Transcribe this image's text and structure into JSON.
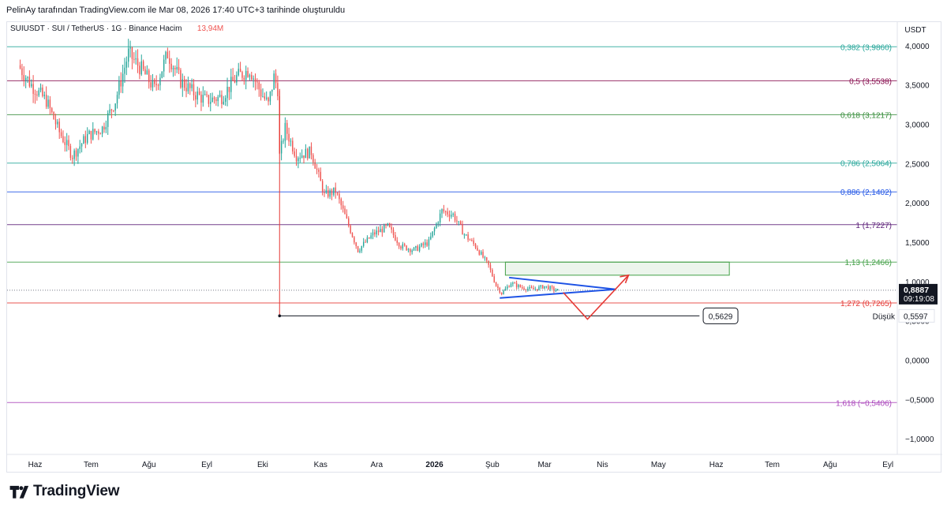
{
  "header": {
    "caption": "PelinAy tarafından TradingView.com ile Mar 08, 2026 17:40 UTC+3 tarihinde oluşturuldu"
  },
  "brand": {
    "name": "TradingView",
    "logo_icon": "tradingview-logo-icon"
  },
  "chart_data": {
    "type": "candlestick",
    "symbol_line": "SUIUSDT · SUI / TetherUS · 1G · Binance",
    "volume_label": "Hacim",
    "volume_value": "13,94M",
    "currency": "USDT",
    "ylim": [
      -1.2,
      4.3
    ],
    "y_ticks": [
      "4,0000",
      "3,5000",
      "3,0000",
      "2,5000",
      "2,0000",
      "1,5000",
      "1,0000",
      "0,5000",
      "0,0000",
      "−0,5000",
      "−1,0000"
    ],
    "x_ticks": [
      "Haz",
      "Tem",
      "Ağu",
      "Eyl",
      "Eki",
      "Kas",
      "Ara",
      "2026",
      "Şub",
      "Mar",
      "Nis",
      "May",
      "Haz",
      "Tem",
      "Ağu",
      "Eyl"
    ],
    "x_months": [
      "2025-06",
      "2025-07",
      "2025-08",
      "2025-09",
      "2025-10",
      "2025-11",
      "2025-12",
      "2026-01",
      "2026-02",
      "2026-03",
      "2026-04",
      "2026-05",
      "2026-06",
      "2026-07",
      "2026-08",
      "2026-09"
    ],
    "price_path": [
      [
        "2025-05-24",
        3.75
      ],
      [
        "2025-05-31",
        3.5
      ],
      [
        "2025-06-08",
        3.3
      ],
      [
        "2025-06-15",
        2.9
      ],
      [
        "2025-06-22",
        2.6
      ],
      [
        "2025-06-30",
        2.85
      ],
      [
        "2025-07-08",
        2.95
      ],
      [
        "2025-07-15",
        3.3
      ],
      [
        "2025-07-22",
        3.9
      ],
      [
        "2025-07-29",
        3.7
      ],
      [
        "2025-08-05",
        3.45
      ],
      [
        "2025-08-12",
        3.9
      ],
      [
        "2025-08-19",
        3.55
      ],
      [
        "2025-08-26",
        3.4
      ],
      [
        "2025-09-02",
        3.3
      ],
      [
        "2025-09-10",
        3.35
      ],
      [
        "2025-09-18",
        3.6
      ],
      [
        "2025-09-25",
        3.7
      ],
      [
        "2025-10-01",
        3.4
      ],
      [
        "2025-10-05",
        3.25
      ],
      [
        "2025-10-08",
        3.6
      ],
      [
        "2025-10-10",
        3.45
      ],
      [
        "2025-10-11",
        2.6
      ],
      [
        "2025-10-14",
        2.95
      ],
      [
        "2025-10-20",
        2.6
      ],
      [
        "2025-10-28",
        2.65
      ],
      [
        "2025-11-04",
        2.1
      ],
      [
        "2025-11-10",
        2.15
      ],
      [
        "2025-11-18",
        1.65
      ],
      [
        "2025-11-22",
        1.4
      ],
      [
        "2025-11-30",
        1.6
      ],
      [
        "2025-12-08",
        1.7
      ],
      [
        "2025-12-15",
        1.45
      ],
      [
        "2025-12-22",
        1.4
      ],
      [
        "2025-12-30",
        1.5
      ],
      [
        "2026-01-06",
        1.9
      ],
      [
        "2026-01-12",
        1.85
      ],
      [
        "2026-01-18",
        1.6
      ],
      [
        "2026-01-24",
        1.45
      ],
      [
        "2026-01-31",
        1.2
      ],
      [
        "2026-02-04",
        0.95
      ],
      [
        "2026-02-07",
        0.85
      ],
      [
        "2026-02-12",
        0.98
      ],
      [
        "2026-02-18",
        0.92
      ],
      [
        "2026-02-24",
        0.9
      ],
      [
        "2026-03-02",
        0.94
      ],
      [
        "2026-03-08",
        0.8887
      ]
    ],
    "last_price": "0,8887",
    "countdown": "09:19:08",
    "low_label": "Düşük",
    "low_value": "0,5597",
    "low_callout": "0,5629",
    "fib_levels": [
      {
        "label": "0,382 (3,9860)",
        "price": 3.986,
        "color": "#26a69a"
      },
      {
        "label": "0,5 (3,5538)",
        "price": 3.5538,
        "color": "#880e4f"
      },
      {
        "label": "0,618 (3,1217)",
        "price": 3.1217,
        "color": "#388e3c"
      },
      {
        "label": "0,786 (2,5064)",
        "price": 2.5064,
        "color": "#26a69a"
      },
      {
        "label": "0,886 (2,1402)",
        "price": 2.1402,
        "color": "#1e53e5"
      },
      {
        "label": "1 (1,7227)",
        "price": 1.7227,
        "color": "#5b1e78"
      },
      {
        "label": "1,13 (1,2466)",
        "price": 1.2466,
        "color": "#43a047"
      },
      {
        "label": "1,272 (0,7265)",
        "price": 0.7265,
        "color": "#e53935"
      },
      {
        "label": "1,618 (−0,5406)",
        "price": -0.5406,
        "color": "#ab47bc"
      }
    ],
    "colors": {
      "up": "#26a69a",
      "down": "#ef5350",
      "wedge": "#1e53e5",
      "projection": "#e53935",
      "zone": "#43a047"
    }
  }
}
